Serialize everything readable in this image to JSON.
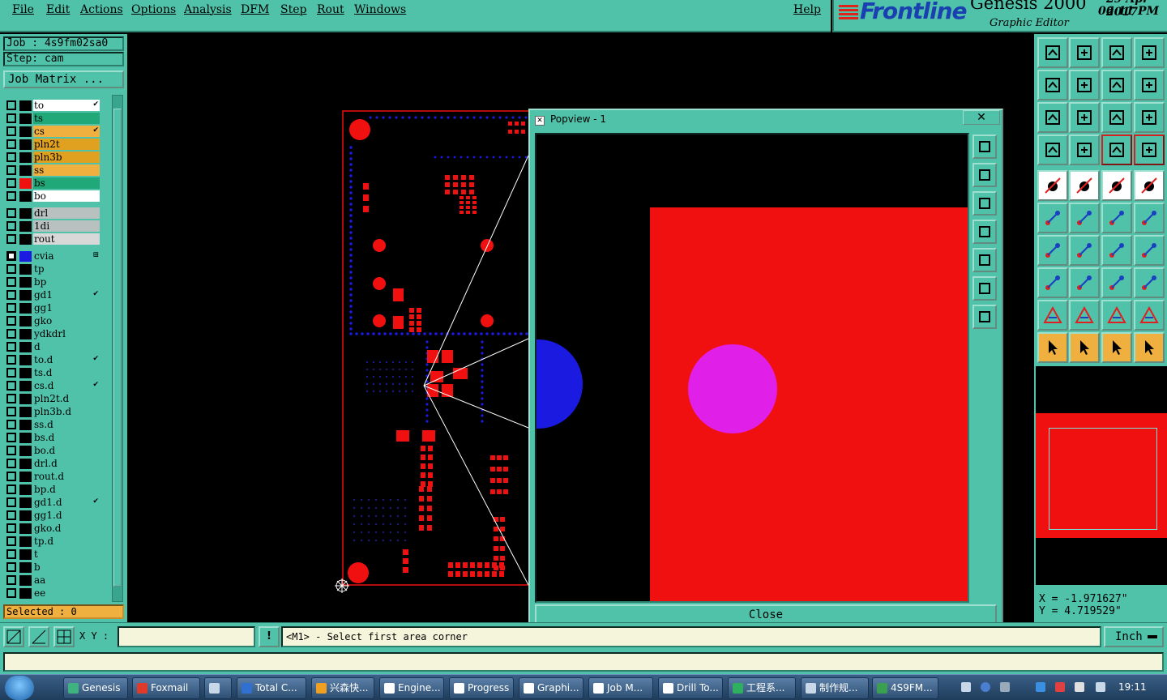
{
  "menu": {
    "items": [
      "File",
      "Edit",
      "Actions",
      "Options",
      "Analysis",
      "DFM",
      "Step",
      "Rout",
      "Windows"
    ],
    "help": "Help"
  },
  "branding": {
    "logo": "Frontline",
    "product": "Genesis 2000",
    "subtitle": "Graphic Editor",
    "date": "29 Apr 2017",
    "time": "06:11 PM"
  },
  "job": {
    "job_label": "Job : 4s9fm02sa0",
    "step_label": "Step: cam",
    "matrix_button": "Job Matrix ..."
  },
  "layers": [
    {
      "name": "to",
      "color": "#ffffff",
      "checked": false,
      "mark": "✔"
    },
    {
      "name": "ts",
      "color": "#20a878",
      "checked": false,
      "mark": ""
    },
    {
      "name": "cs",
      "color": "#f0b040",
      "checked": false,
      "mark": "✔"
    },
    {
      "name": "pln2t",
      "color": "#e0a020",
      "checked": false,
      "mark": ""
    },
    {
      "name": "pln3b",
      "color": "#e0a020",
      "checked": false,
      "mark": ""
    },
    {
      "name": "ss",
      "color": "#f0b040",
      "checked": false,
      "mark": ""
    },
    {
      "name": "bs",
      "color": "#20a878",
      "checked": false,
      "mark": "",
      "display_color": "#f01010"
    },
    {
      "name": "bo",
      "color": "#ffffff",
      "checked": false,
      "mark": ""
    },
    {
      "name": "drl",
      "color": "#b8c0c0",
      "checked": false,
      "mark": "",
      "gap": true
    },
    {
      "name": "1di",
      "color": "#b8c0c0",
      "checked": false,
      "mark": ""
    },
    {
      "name": "rout",
      "color": "#d8d8d8",
      "checked": false,
      "mark": ""
    },
    {
      "name": "cvia",
      "color": "#4fc2a9",
      "checked": true,
      "mark": "⊞",
      "gap": true,
      "display_color": "#1a1ae0"
    },
    {
      "name": "tp",
      "color": "#4fc2a9",
      "checked": false,
      "mark": ""
    },
    {
      "name": "bp",
      "color": "#4fc2a9",
      "checked": false,
      "mark": ""
    },
    {
      "name": "gd1",
      "color": "#4fc2a9",
      "checked": false,
      "mark": "✔"
    },
    {
      "name": "gg1",
      "color": "#4fc2a9",
      "checked": false,
      "mark": ""
    },
    {
      "name": "gko",
      "color": "#4fc2a9",
      "checked": false,
      "mark": ""
    },
    {
      "name": "ydkdrl",
      "color": "#4fc2a9",
      "checked": false,
      "mark": ""
    },
    {
      "name": "d",
      "color": "#4fc2a9",
      "checked": false,
      "mark": ""
    },
    {
      "name": "to.d",
      "color": "#4fc2a9",
      "checked": false,
      "mark": "✔"
    },
    {
      "name": "ts.d",
      "color": "#4fc2a9",
      "checked": false,
      "mark": ""
    },
    {
      "name": "cs.d",
      "color": "#4fc2a9",
      "checked": false,
      "mark": "✔"
    },
    {
      "name": "pln2t.d",
      "color": "#4fc2a9",
      "checked": false,
      "mark": ""
    },
    {
      "name": "pln3b.d",
      "color": "#4fc2a9",
      "checked": false,
      "mark": ""
    },
    {
      "name": "ss.d",
      "color": "#4fc2a9",
      "checked": false,
      "mark": ""
    },
    {
      "name": "bs.d",
      "color": "#4fc2a9",
      "checked": false,
      "mark": ""
    },
    {
      "name": "bo.d",
      "color": "#4fc2a9",
      "checked": false,
      "mark": ""
    },
    {
      "name": "drl.d",
      "color": "#4fc2a9",
      "checked": false,
      "mark": ""
    },
    {
      "name": "rout.d",
      "color": "#4fc2a9",
      "checked": false,
      "mark": ""
    },
    {
      "name": "bp.d",
      "color": "#4fc2a9",
      "checked": false,
      "mark": ""
    },
    {
      "name": "gd1.d",
      "color": "#4fc2a9",
      "checked": false,
      "mark": "✔"
    },
    {
      "name": "gg1.d",
      "color": "#4fc2a9",
      "checked": false,
      "mark": ""
    },
    {
      "name": "gko.d",
      "color": "#4fc2a9",
      "checked": false,
      "mark": ""
    },
    {
      "name": "tp.d",
      "color": "#4fc2a9",
      "checked": false,
      "mark": ""
    },
    {
      "name": "t",
      "color": "#4fc2a9",
      "checked": false,
      "mark": ""
    },
    {
      "name": "b",
      "color": "#4fc2a9",
      "checked": false,
      "mark": ""
    },
    {
      "name": "aa",
      "color": "#4fc2a9",
      "checked": false,
      "mark": ""
    },
    {
      "name": "ee",
      "color": "#4fc2a9",
      "checked": false,
      "mark": ""
    }
  ],
  "selected": "Selected : 0",
  "popview": {
    "title": "Popview - 1",
    "close_x": "✕",
    "close_button": "Close"
  },
  "coords": {
    "x": "X = -1.971627\"",
    "y": "Y = 4.719529\""
  },
  "status": {
    "xy_label": "X Y :",
    "xy_value": "",
    "exclaim": "!",
    "prompt": "<M1> - Select first area corner",
    "unit": "Inch"
  },
  "taskbar": {
    "items": [
      {
        "label": "Genesis",
        "icon_color": "#3fb37f"
      },
      {
        "label": "Foxmail",
        "icon_color": "#e03a2a"
      },
      {
        "label": "",
        "icon_color": "#c8d8e8"
      },
      {
        "label": "Total C...",
        "icon_color": "#3070d0"
      },
      {
        "label": "兴森快...",
        "icon_color": "#f0a020"
      },
      {
        "label": "Engine...",
        "icon_color": "#ffffff"
      },
      {
        "label": "Progress",
        "icon_color": "#ffffff"
      },
      {
        "label": "Graphi...",
        "icon_color": "#ffffff"
      },
      {
        "label": "Job M...",
        "icon_color": "#ffffff"
      },
      {
        "label": "Drill To...",
        "icon_color": "#ffffff"
      },
      {
        "label": "工程系...",
        "icon_color": "#2fb060"
      },
      {
        "label": "制作规...",
        "icon_color": "#c8d8e8"
      },
      {
        "label": "4S9FM...",
        "icon_color": "#3aa050"
      }
    ],
    "clock": "19:11"
  },
  "colors": {
    "panel": "#4fc2a9",
    "pad_red": "#f01010",
    "via_blue": "#1a1ae0",
    "magenta": "#e020e8"
  }
}
